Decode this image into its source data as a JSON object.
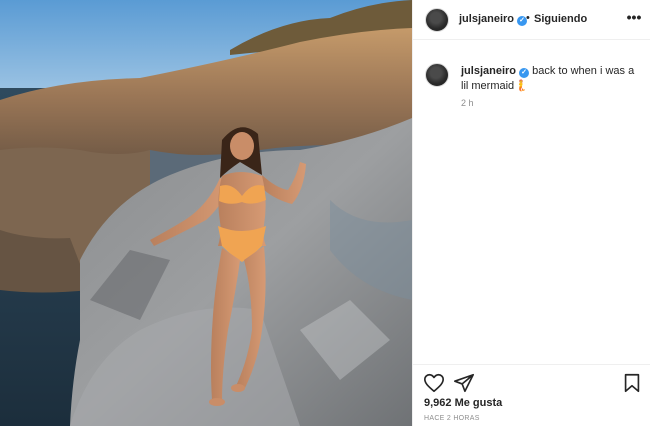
{
  "post": {
    "author": {
      "username": "julsjaneiro",
      "verified_icon": "verified-badge-icon",
      "follow_separator": "•",
      "follow_state": "Siguiendo"
    },
    "caption": {
      "username": "julsjaneiro",
      "text": "back to when i was a lil mermaid🧜",
      "time": "2 h"
    },
    "actions": {
      "like_icon": "heart-icon",
      "share_icon": "paper-plane-icon",
      "save_icon": "bookmark-icon",
      "more_icon": "more-options-icon"
    },
    "likes": "9,962 Me gusta",
    "posted_ago": "HACE 2 HORAS",
    "colors": {
      "verified": "#3897f0",
      "text": "#262626",
      "muted": "#8e8e8e",
      "divider": "#efefef"
    }
  }
}
